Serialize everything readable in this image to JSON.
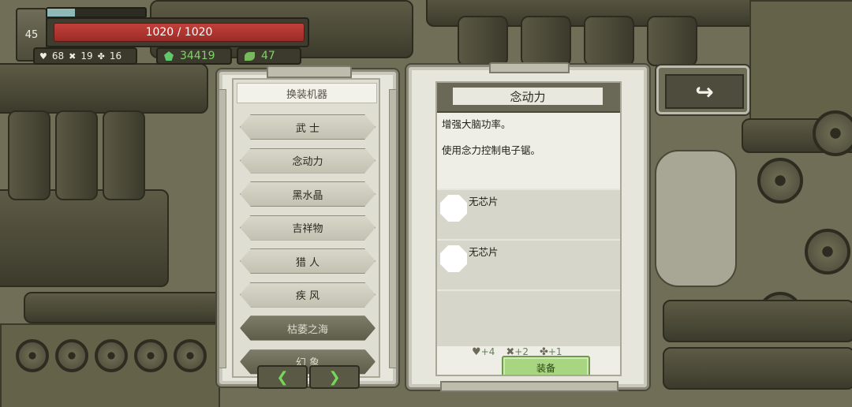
{
  "hud": {
    "level": "45",
    "hp_text": "1020 / 1020",
    "stats": {
      "heart": "68",
      "cross": "19",
      "clover": "16"
    },
    "gems": "34419",
    "parts": "47",
    "colors": {
      "hp": "#b63530",
      "gem_text": "#7fd36a"
    }
  },
  "mech_panel": {
    "title": "换装机器",
    "items": [
      {
        "label": "武 士",
        "style": "light"
      },
      {
        "label": "念动力",
        "style": "light"
      },
      {
        "label": "黑水晶",
        "style": "light"
      },
      {
        "label": "吉祥物",
        "style": "light"
      },
      {
        "label": "猎 人",
        "style": "light"
      },
      {
        "label": "疾 风",
        "style": "light"
      },
      {
        "label": "枯萎之海",
        "style": "dark"
      },
      {
        "label": "幻 象",
        "style": "dark"
      }
    ],
    "prev_icon": "chevron-left-icon",
    "next_icon": "chevron-right-icon"
  },
  "detail_panel": {
    "title": "念动力",
    "desc_line1": "增强大脑功率。",
    "desc_line2": "使用念力控制电子锯。",
    "slots": [
      {
        "label": "无芯片"
      },
      {
        "label": "无芯片"
      }
    ],
    "requirements": {
      "heart": "+4",
      "cross": "+2",
      "clover": "+1"
    },
    "equip_label": "装备",
    "equip_color": "#a8d57f"
  },
  "back_button": {
    "icon": "back-arrow-icon"
  }
}
